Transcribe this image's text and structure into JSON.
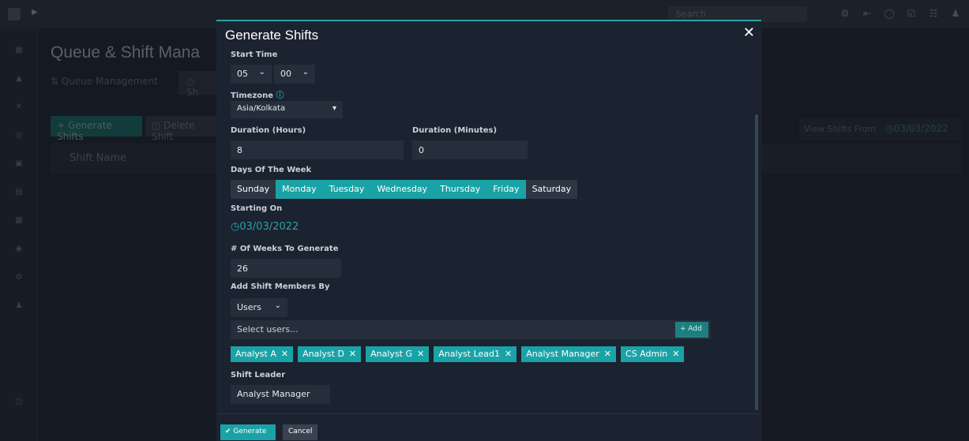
{
  "app": {
    "page_title": "Queue & Shift Mana",
    "tabs": [
      "Queue Management",
      "Sh"
    ],
    "generate_button": "+ Generate Shifts",
    "delete_button": "Delete Shift",
    "table_header": "Shift Name",
    "view_shifts_from_label": "View Shifts From",
    "view_shifts_from_date": "03/03/2022",
    "search_placeholder": "Search"
  },
  "modal": {
    "title": "Generate Shifts",
    "start_time_label": "Start Time",
    "start_hour": "05",
    "start_minute": "00",
    "timezone_label": "Timezone",
    "timezone_value": "Asia/Kolkata",
    "duration_hours_label": "Duration (Hours)",
    "duration_hours_value": "8",
    "duration_minutes_label": "Duration (Minutes)",
    "duration_minutes_value": "0",
    "days_label": "Days Of The Week",
    "days": [
      {
        "label": "Sunday",
        "selected": false
      },
      {
        "label": "Monday",
        "selected": true
      },
      {
        "label": "Tuesday",
        "selected": true
      },
      {
        "label": "Wednesday",
        "selected": true
      },
      {
        "label": "Thursday",
        "selected": true
      },
      {
        "label": "Friday",
        "selected": true
      },
      {
        "label": "Saturday",
        "selected": false
      }
    ],
    "starting_on_label": "Starting On",
    "starting_on_value": "03/03/2022",
    "weeks_label": "# Of Weeks To Generate",
    "weeks_value": "26",
    "members_by_label": "Add Shift Members By",
    "members_by_value": "Users",
    "users_placeholder": "Select users...",
    "add_label": "+ Add",
    "members": [
      "Analyst A",
      "Analyst D",
      "Analyst G",
      "Analyst Lead1",
      "Analyst Manager",
      "CS Admin"
    ],
    "shift_leader_label": "Shift Leader",
    "shift_leader_value": "Analyst Manager",
    "generate_label": "Generate",
    "cancel_label": "Cancel"
  },
  "colors": {
    "accent": "#1aa3a6",
    "modal_bg": "#1b2230"
  }
}
